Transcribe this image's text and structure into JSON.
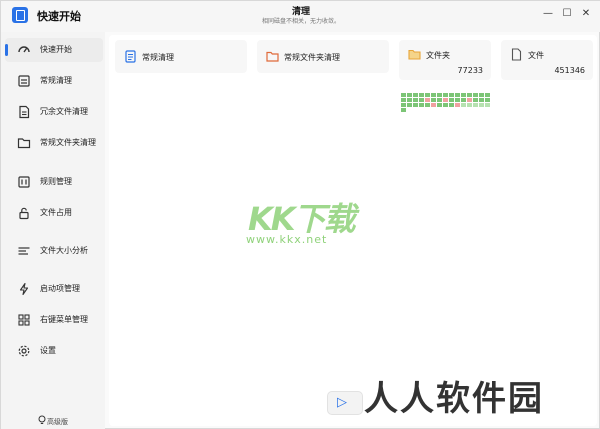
{
  "app": {
    "title": "快速开始",
    "center_title": "清理",
    "center_subtitle": "相同磁盘不相关，无力收敛。"
  },
  "window_controls": {
    "minimize": "—",
    "maximize": "☐",
    "close": "✕"
  },
  "sidebar": {
    "items": [
      {
        "label": "快速开始",
        "icon": "dashboard-icon",
        "active": true
      },
      {
        "label": "常规清理",
        "icon": "clean-icon",
        "active": false
      },
      {
        "label": "冗余文件清理",
        "icon": "file-icon",
        "active": false
      },
      {
        "label": "常规文件夹清理",
        "icon": "folder-icon",
        "active": false
      },
      {
        "label": "规则管理",
        "icon": "rules-icon",
        "active": false
      },
      {
        "label": "文件占用",
        "icon": "lock-icon",
        "active": false
      },
      {
        "label": "文件大小分析",
        "icon": "bars-icon",
        "active": false
      },
      {
        "label": "启动项管理",
        "icon": "startup-icon",
        "active": false
      },
      {
        "label": "右键菜单管理",
        "icon": "menu-icon",
        "active": false
      },
      {
        "label": "设置",
        "icon": "gear-icon",
        "active": false
      }
    ],
    "version": "高级版"
  },
  "cards": [
    {
      "label": "常规清理",
      "icon": "document-icon"
    },
    {
      "label": "常规文件夹清理",
      "icon": "folder-icon"
    },
    {
      "label": "文件夹",
      "icon": "folder-icon",
      "count": "77233"
    },
    {
      "label": "文件",
      "icon": "file-icon",
      "count": "451346"
    }
  ],
  "watermarks": {
    "logo": "KK下载",
    "url": "www.kkx.net",
    "corner": "人人软件园"
  },
  "colors": {
    "accent": "#2a72e6",
    "sidebar_bg": "#f4f4f4",
    "card_bg": "#f7f7f7",
    "folder": "#e8a53a"
  }
}
